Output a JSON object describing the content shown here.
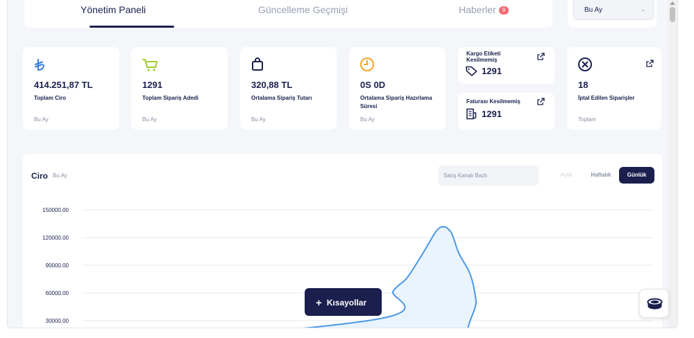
{
  "tabs": {
    "items": [
      {
        "label": "Yönetim Paneli",
        "active": true
      },
      {
        "label": "Güncelleme Geçmişi",
        "active": false
      },
      {
        "label": "Haberler",
        "active": false,
        "badge": "9"
      }
    ]
  },
  "period_select": {
    "value": "Bu Ay",
    "icon": "chevron-down-icon"
  },
  "stats": {
    "revenue": {
      "icon": "lira-icon",
      "value": "414.251,87 TL",
      "label": "Toplam Ciro",
      "period": "Bu Ay"
    },
    "orders": {
      "icon": "cart-icon",
      "value": "1291",
      "label": "Toplam Sipariş Adedi",
      "period": "Bu Ay"
    },
    "avg_order": {
      "icon": "shopping-bag-icon",
      "value": "320,88 TL",
      "label": "Ortalama Sipariş Tutarı",
      "period": "Bu Ay"
    },
    "prep_time": {
      "icon": "clock-icon",
      "value": "0S 0D",
      "label": "Ortalama Sipariş Hazırlama Süresi",
      "period": "Bu Ay"
    },
    "label_not_cut": {
      "icon": "tag-icon",
      "title": "Kargo Etiketi Kesilmemiş",
      "value": "1291"
    },
    "invoice_not_cut": {
      "icon": "invoice-icon",
      "title": "Faturası Kesilmemiş",
      "value": "1291"
    },
    "cancelled": {
      "icon": "x-circle-icon",
      "value": "18",
      "label": "İptal Edilen Siparişler",
      "period": "Toplam"
    }
  },
  "revenue_chart": {
    "title": "Ciro",
    "subtitle": "Bu Ay",
    "channel_placeholder": "Satış Kanalı Bazlı",
    "segments": [
      {
        "label": "Aylık",
        "state": "disabled"
      },
      {
        "label": "Haftalık",
        "state": "normal"
      },
      {
        "label": "Günlük",
        "state": "active"
      }
    ]
  },
  "chart_data": {
    "type": "area",
    "y_ticks": [
      "150000.00",
      "120000.00",
      "90000.00",
      "60000.00",
      "30000.00"
    ],
    "ylim": [
      0,
      150000
    ],
    "x": [
      0.0,
      0.52,
      0.545,
      0.57,
      0.6,
      0.625,
      0.645,
      0.66,
      0.68,
      0.69,
      0.7,
      1.0
    ],
    "values": [
      0,
      32000,
      62000,
      77000,
      106000,
      130000,
      127000,
      103000,
      80000,
      52000,
      0,
      0
    ],
    "colors": {
      "line": "#4a97e6",
      "fill": "#eaf4fd"
    },
    "grid": true
  },
  "shortcuts": {
    "label": "Kısayollar"
  },
  "chat_button": {
    "icon": "chat-support-icon"
  },
  "colors": {
    "accent": "#1a1f4d",
    "badge": "#f06a74",
    "lira": "#2f7bd9",
    "cart": "#9ccc2e",
    "clock": "#f5a623",
    "bg": "#f5f6f9"
  }
}
